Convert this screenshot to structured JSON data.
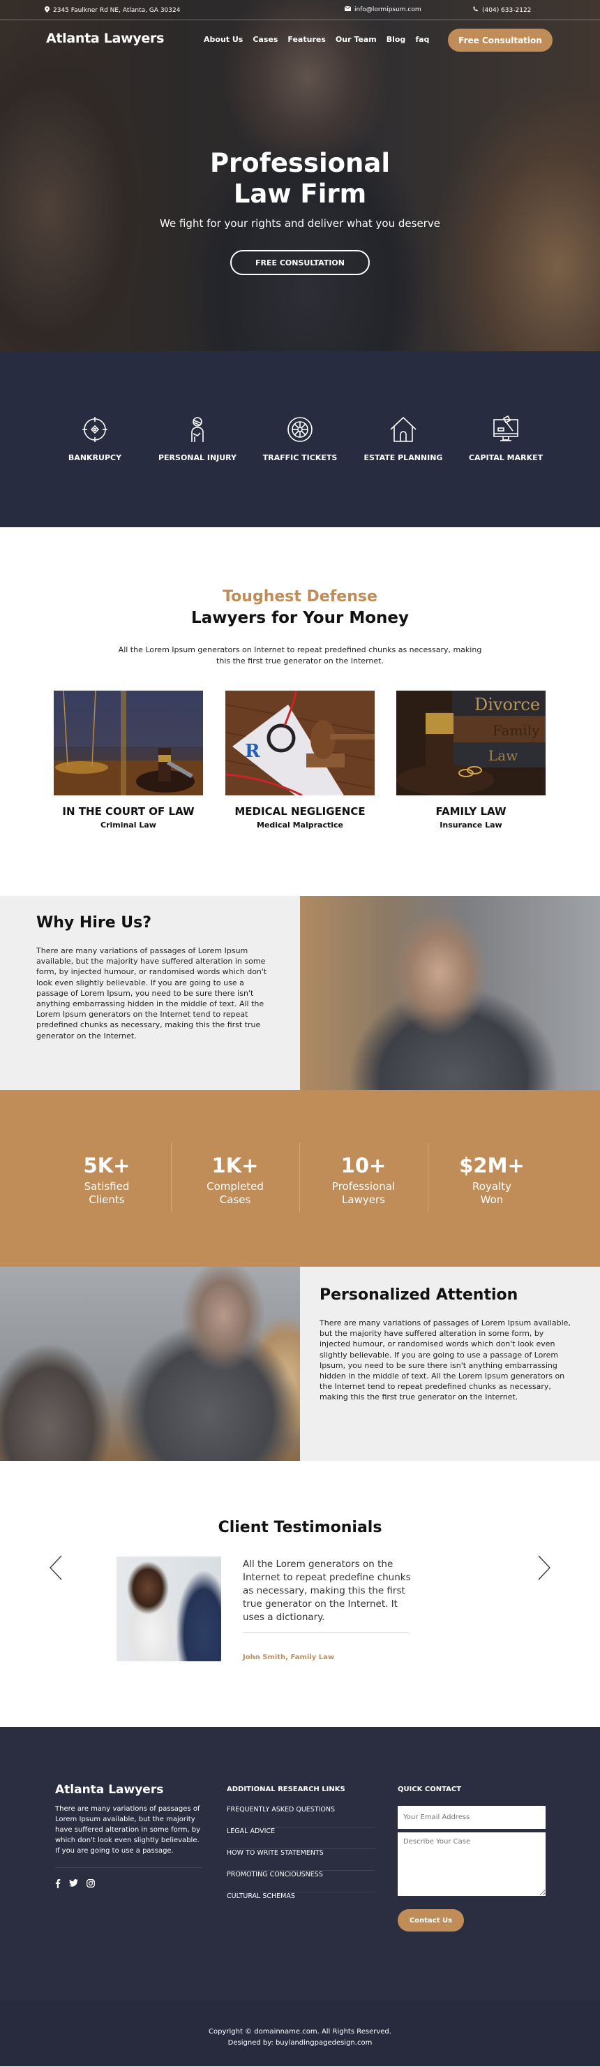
{
  "topbar": {
    "address": "2345 Faulkner Rd NE, Atlanta, GA 30324",
    "email": "info@lormipsum.com",
    "phone": "(404) 633-2122"
  },
  "nav": {
    "logo": "Atlanta Lawyers",
    "items": [
      "About Us",
      "Cases",
      "Features",
      "Our Team",
      "Blog",
      "faq"
    ],
    "cta": "Free Consultation"
  },
  "hero": {
    "title_line1": "Professional",
    "title_line2": "Law Firm",
    "subtitle": "We fight for your rights and deliver what you deserve",
    "button": "FREE CONSULTATION"
  },
  "services": [
    {
      "label": "BANKRUPCY",
      "icon": "target-icon"
    },
    {
      "label": "PERSONAL INJURY",
      "icon": "injured-person-icon"
    },
    {
      "label": "TRAFFIC TICKETS",
      "icon": "tire-icon"
    },
    {
      "label": "ESTATE PLANNING",
      "icon": "house-icon"
    },
    {
      "label": "CAPITAL MARKET",
      "icon": "monitor-gavel-icon"
    }
  ],
  "defense": {
    "kicker": "Toughest Defense",
    "title": "Lawyers for Your Money",
    "description": "All the Lorem Ipsum generators on Internet to repeat predefined chunks as necessary, making this the first true generator on the Internet.",
    "cards": [
      {
        "title": "IN THE COURT OF LAW",
        "subtitle": "Criminal Law"
      },
      {
        "title": "MEDICAL NEGLIGENCE",
        "subtitle": "Medical Malpractice"
      },
      {
        "title": "FAMILY LAW",
        "subtitle": "Insurance Law"
      }
    ],
    "card3_book_labels": [
      "Divorce",
      "Family",
      "Law"
    ]
  },
  "why": {
    "title": "Why Hire Us?",
    "body": "There are many variations of passages of Lorem Ipsum available, but the majority have suffered alteration in some form, by injected humour, or randomised words which don't look even slightly believable. If you are going to use a passage of Lorem Ipsum, you need to be sure there isn't anything embarrassing hidden in the middle of text. All the Lorem Ipsum generators on the Internet tend to repeat predefined chunks as necessary, making this the first true generator on the Internet."
  },
  "stats": [
    {
      "value": "5K+",
      "line1": "Satisfied",
      "line2": "Clients"
    },
    {
      "value": "1K+",
      "line1": "Completed",
      "line2": "Cases"
    },
    {
      "value": "10+",
      "line1": "Professional",
      "line2": "Lawyers"
    },
    {
      "value": "$2M+",
      "line1": "Royalty",
      "line2": "Won"
    }
  ],
  "personalized": {
    "title": "Personalized Attention",
    "body": "There are many variations of passages of Lorem Ipsum available, but the majority have suffered alteration in some form, by injected humour, or randomised words which don't look even slightly believable. If you are going to use a passage of Lorem Ipsum, you need to be sure there isn't anything embarrassing hidden in the middle of text. All the Lorem Ipsum generators on the Internet tend to repeat predefined chunks as necessary, making this the first true generator on the Internet."
  },
  "testimonials": {
    "title": "Client Testimonials",
    "quote": "All the Lorem generators on the Internet to repeat predefine chunks as necessary, making this the first true generator on the Internet. It uses a dictionary.",
    "author": "John Smith, Family Law"
  },
  "footer": {
    "logo": "Atlanta Lawyers",
    "about": "There are many variations of passages of Lorem Ipsum available, but the majority have suffered alteration in some form, by which don't look even slightly believable. If you are going to use a passage.",
    "social": [
      "facebook-icon",
      "twitter-icon",
      "instagram-icon"
    ],
    "links_title": "ADDITIONAL RESEARCH LINKS",
    "links": [
      "FREQUENTLY ASKED QUESTIONS",
      "LEGAL ADVICE",
      "HOW TO WRITE STATEMENTS",
      "PROMOTING CONCIOUSNESS",
      "CULTURAL SCHEMAS"
    ],
    "contact_title": "QUICK CONTACT",
    "email_placeholder": "Your Email Address",
    "case_placeholder": "Describe Your Case",
    "contact_button": "Contact Us"
  },
  "bottom": {
    "copyright": "Copyright © domainname.com. All Rights Reserved.",
    "designed_by": "Designed by: buylandingpagedesign.com"
  },
  "colors": {
    "accent": "#c08d58",
    "navy": "#272c40",
    "light_gray": "#efefef"
  }
}
